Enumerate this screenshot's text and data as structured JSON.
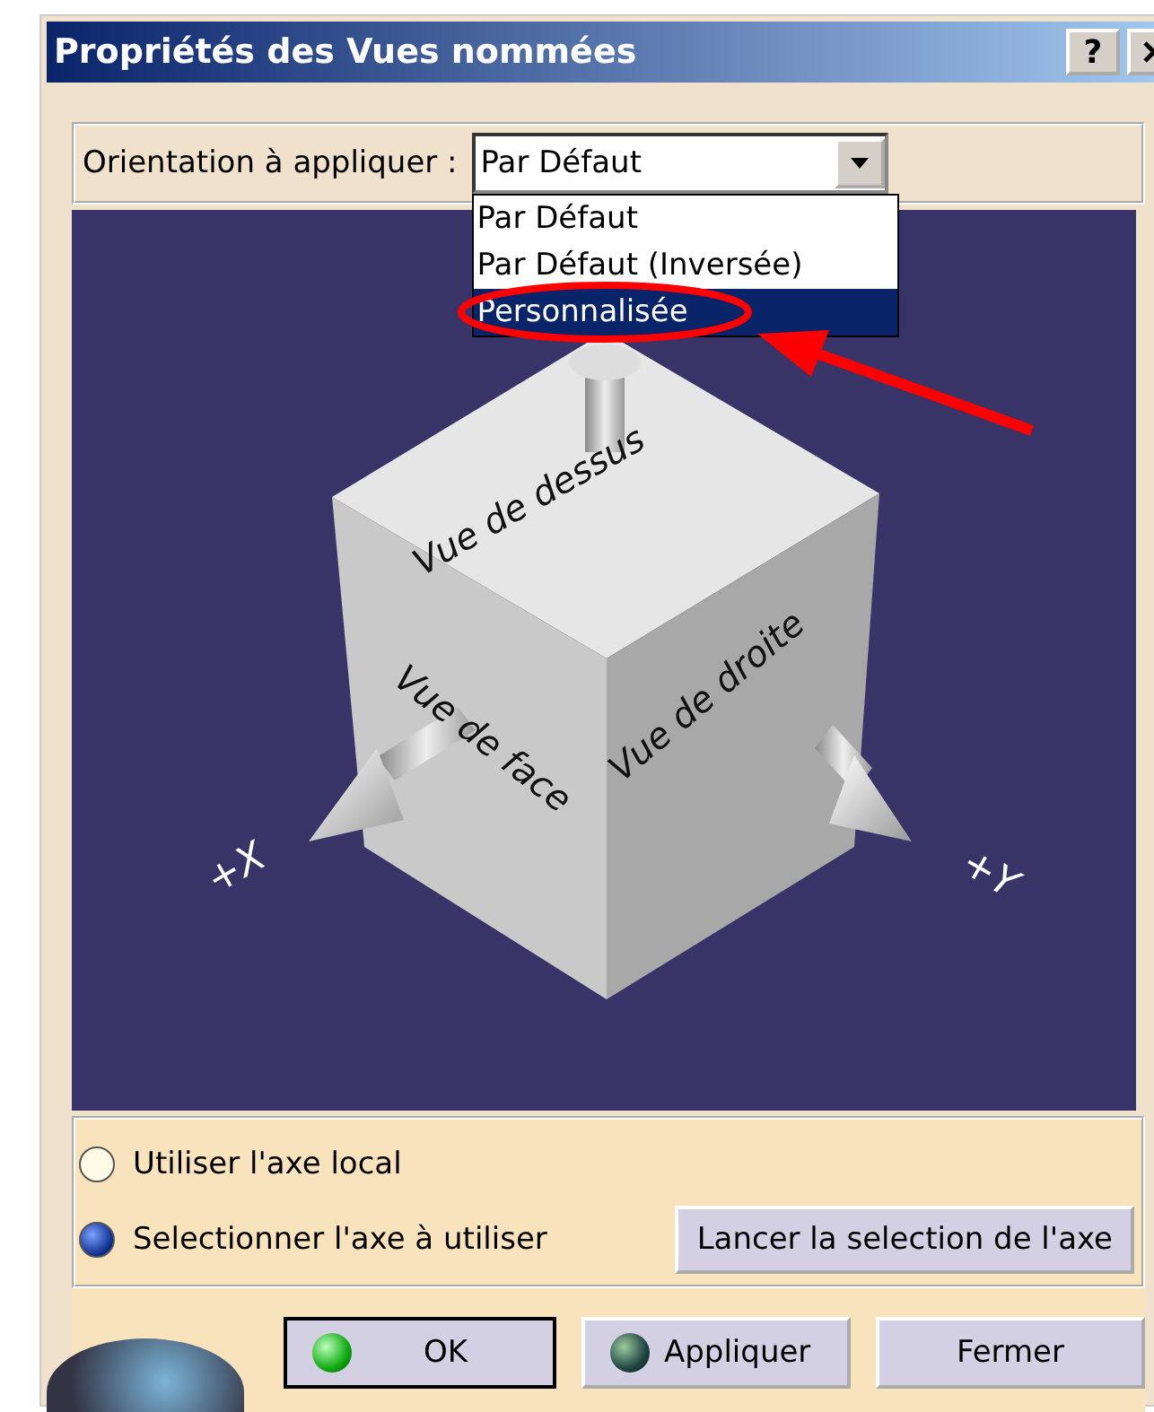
{
  "window": {
    "title": "Propriétés des Vues nommées",
    "help_button": "?"
  },
  "orientation": {
    "label": "Orientation à appliquer :",
    "value": "Par Défaut",
    "expanded": true,
    "options": [
      {
        "label": "Par Défaut",
        "highlighted": false
      },
      {
        "label": "Par Défaut (Inversée)",
        "highlighted": false
      },
      {
        "label": "Personnalisée",
        "highlighted": true
      }
    ]
  },
  "viewer": {
    "top_face": "Vue de dessus",
    "front_face": "Vue de face",
    "right_face": "Vue de droite",
    "x_axis": "+X",
    "y_axis": "+Y"
  },
  "axis_options": [
    {
      "label": "Utiliser l'axe local",
      "selected": false
    },
    {
      "label": "Selectionner l'axe à utiliser",
      "selected": true
    }
  ],
  "select_axis_button": "Lancer la selection de l'axe",
  "buttons": [
    {
      "label": "OK",
      "kind": "ok"
    },
    {
      "label": "Appliquer",
      "kind": "apply"
    },
    {
      "label": "Fermer",
      "kind": "close"
    }
  ]
}
